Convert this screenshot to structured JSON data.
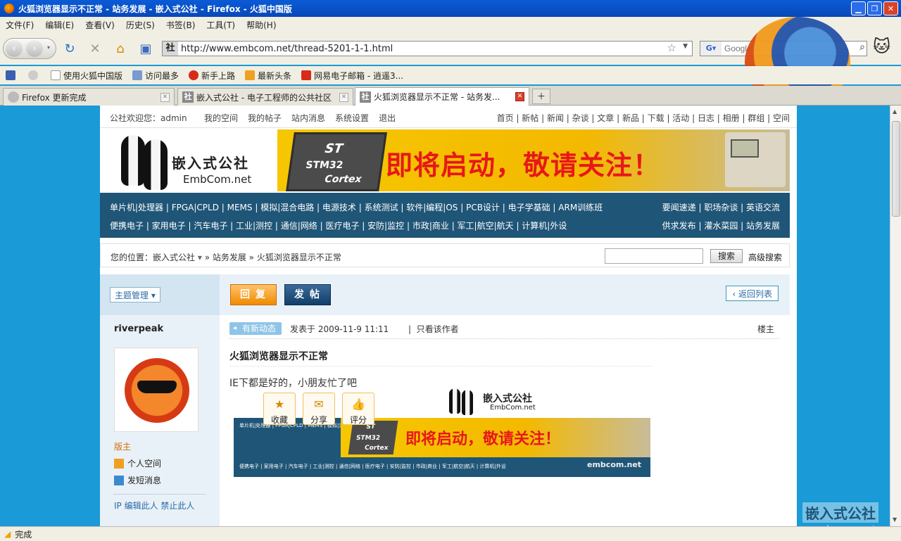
{
  "window": {
    "title": "火狐浏览器显示不正常 - 站务发展 - 嵌入式公社 - Firefox - 火狐中国版"
  },
  "menu": [
    "文件(F)",
    "编辑(E)",
    "查看(V)",
    "历史(S)",
    "书签(B)",
    "工具(T)",
    "帮助(H)"
  ],
  "toolbar": {
    "url": "http://www.embcom.net/thread-5201-1-1.html",
    "search_placeholder": "Google"
  },
  "bookmarks": [
    "使用火狐中国版",
    "访问最多",
    "新手上路",
    "最新头条",
    "网易电子邮箱 - 逍遥3..."
  ],
  "tabs": [
    {
      "label": "Firefox 更新完成"
    },
    {
      "label": "嵌入式公社 - 电子工程师的公共社区"
    },
    {
      "label": "火狐浏览器显示不正常 - 站务发..."
    }
  ],
  "site": {
    "welcome": "公社欢迎您：admin",
    "user_links": [
      "我的空间",
      "我的帖子",
      "站内消息",
      "系统设置",
      "退出"
    ],
    "top_links": "首页 | 新帖 | 新闻 | 杂谈 | 文章 | 新品 | 下载 | 活动 | 日志 | 相册 | 群组 | 空间",
    "logo_title": "嵌入式公社",
    "logo_sub": "EmbCom.net",
    "banner_text": "即将启动，敬请关注！",
    "chip_brand": "ST",
    "chip_model": "STM32",
    "chip_core": "Cortex",
    "cat_row1": "单片机|处理器 | FPGA|CPLD | MEMS | 模拟|混合电路 | 电源技术 | 系统测试 | 软件|编程|OS | PCB设计 | 电子学基础 | ARM训练班",
    "cat_row1_right": "要闻速递 | 职场杂谈 | 英语交流",
    "cat_row2": "便携电子 | 家用电子 | 汽车电子 | 工业|测控 | 通信|网络 | 医疗电子 | 安防|监控 | 市政|商业 | 军工|航空|航天 | 计算机|外设",
    "cat_row2_right": "供求发布 | 灌水菜园 | 站务发展"
  },
  "breadcrumb": {
    "prefix": "您的位置：",
    "home": "嵌入式公社",
    "trail": "» 站务发展 » 火狐浏览器显示不正常",
    "search_button": "搜索",
    "advanced": "高级搜索"
  },
  "actions": {
    "topic_manage": "主题管理",
    "reply": "回复",
    "post": "发帖",
    "back_list": "返回列表"
  },
  "author": {
    "name": "riverpeak",
    "role": "版主",
    "space": "个人空间",
    "message": "发短消息",
    "ops": "IP  编辑此人  禁止此人"
  },
  "post": {
    "badge": "有新动态",
    "time": "发表于 2009-11-9 11:11",
    "only_author": "只看该作者",
    "floor": "楼主",
    "title": "火狐浏览器显示不正常",
    "body": "IE下都是好的，小朋友忙了吧",
    "embed_watermark": "embcom.net"
  },
  "post_actions": [
    "收藏",
    "分享",
    "评分"
  ],
  "watermark": {
    "line1": "嵌入式公社",
    "line2": "embcom.net"
  },
  "status": "完成"
}
